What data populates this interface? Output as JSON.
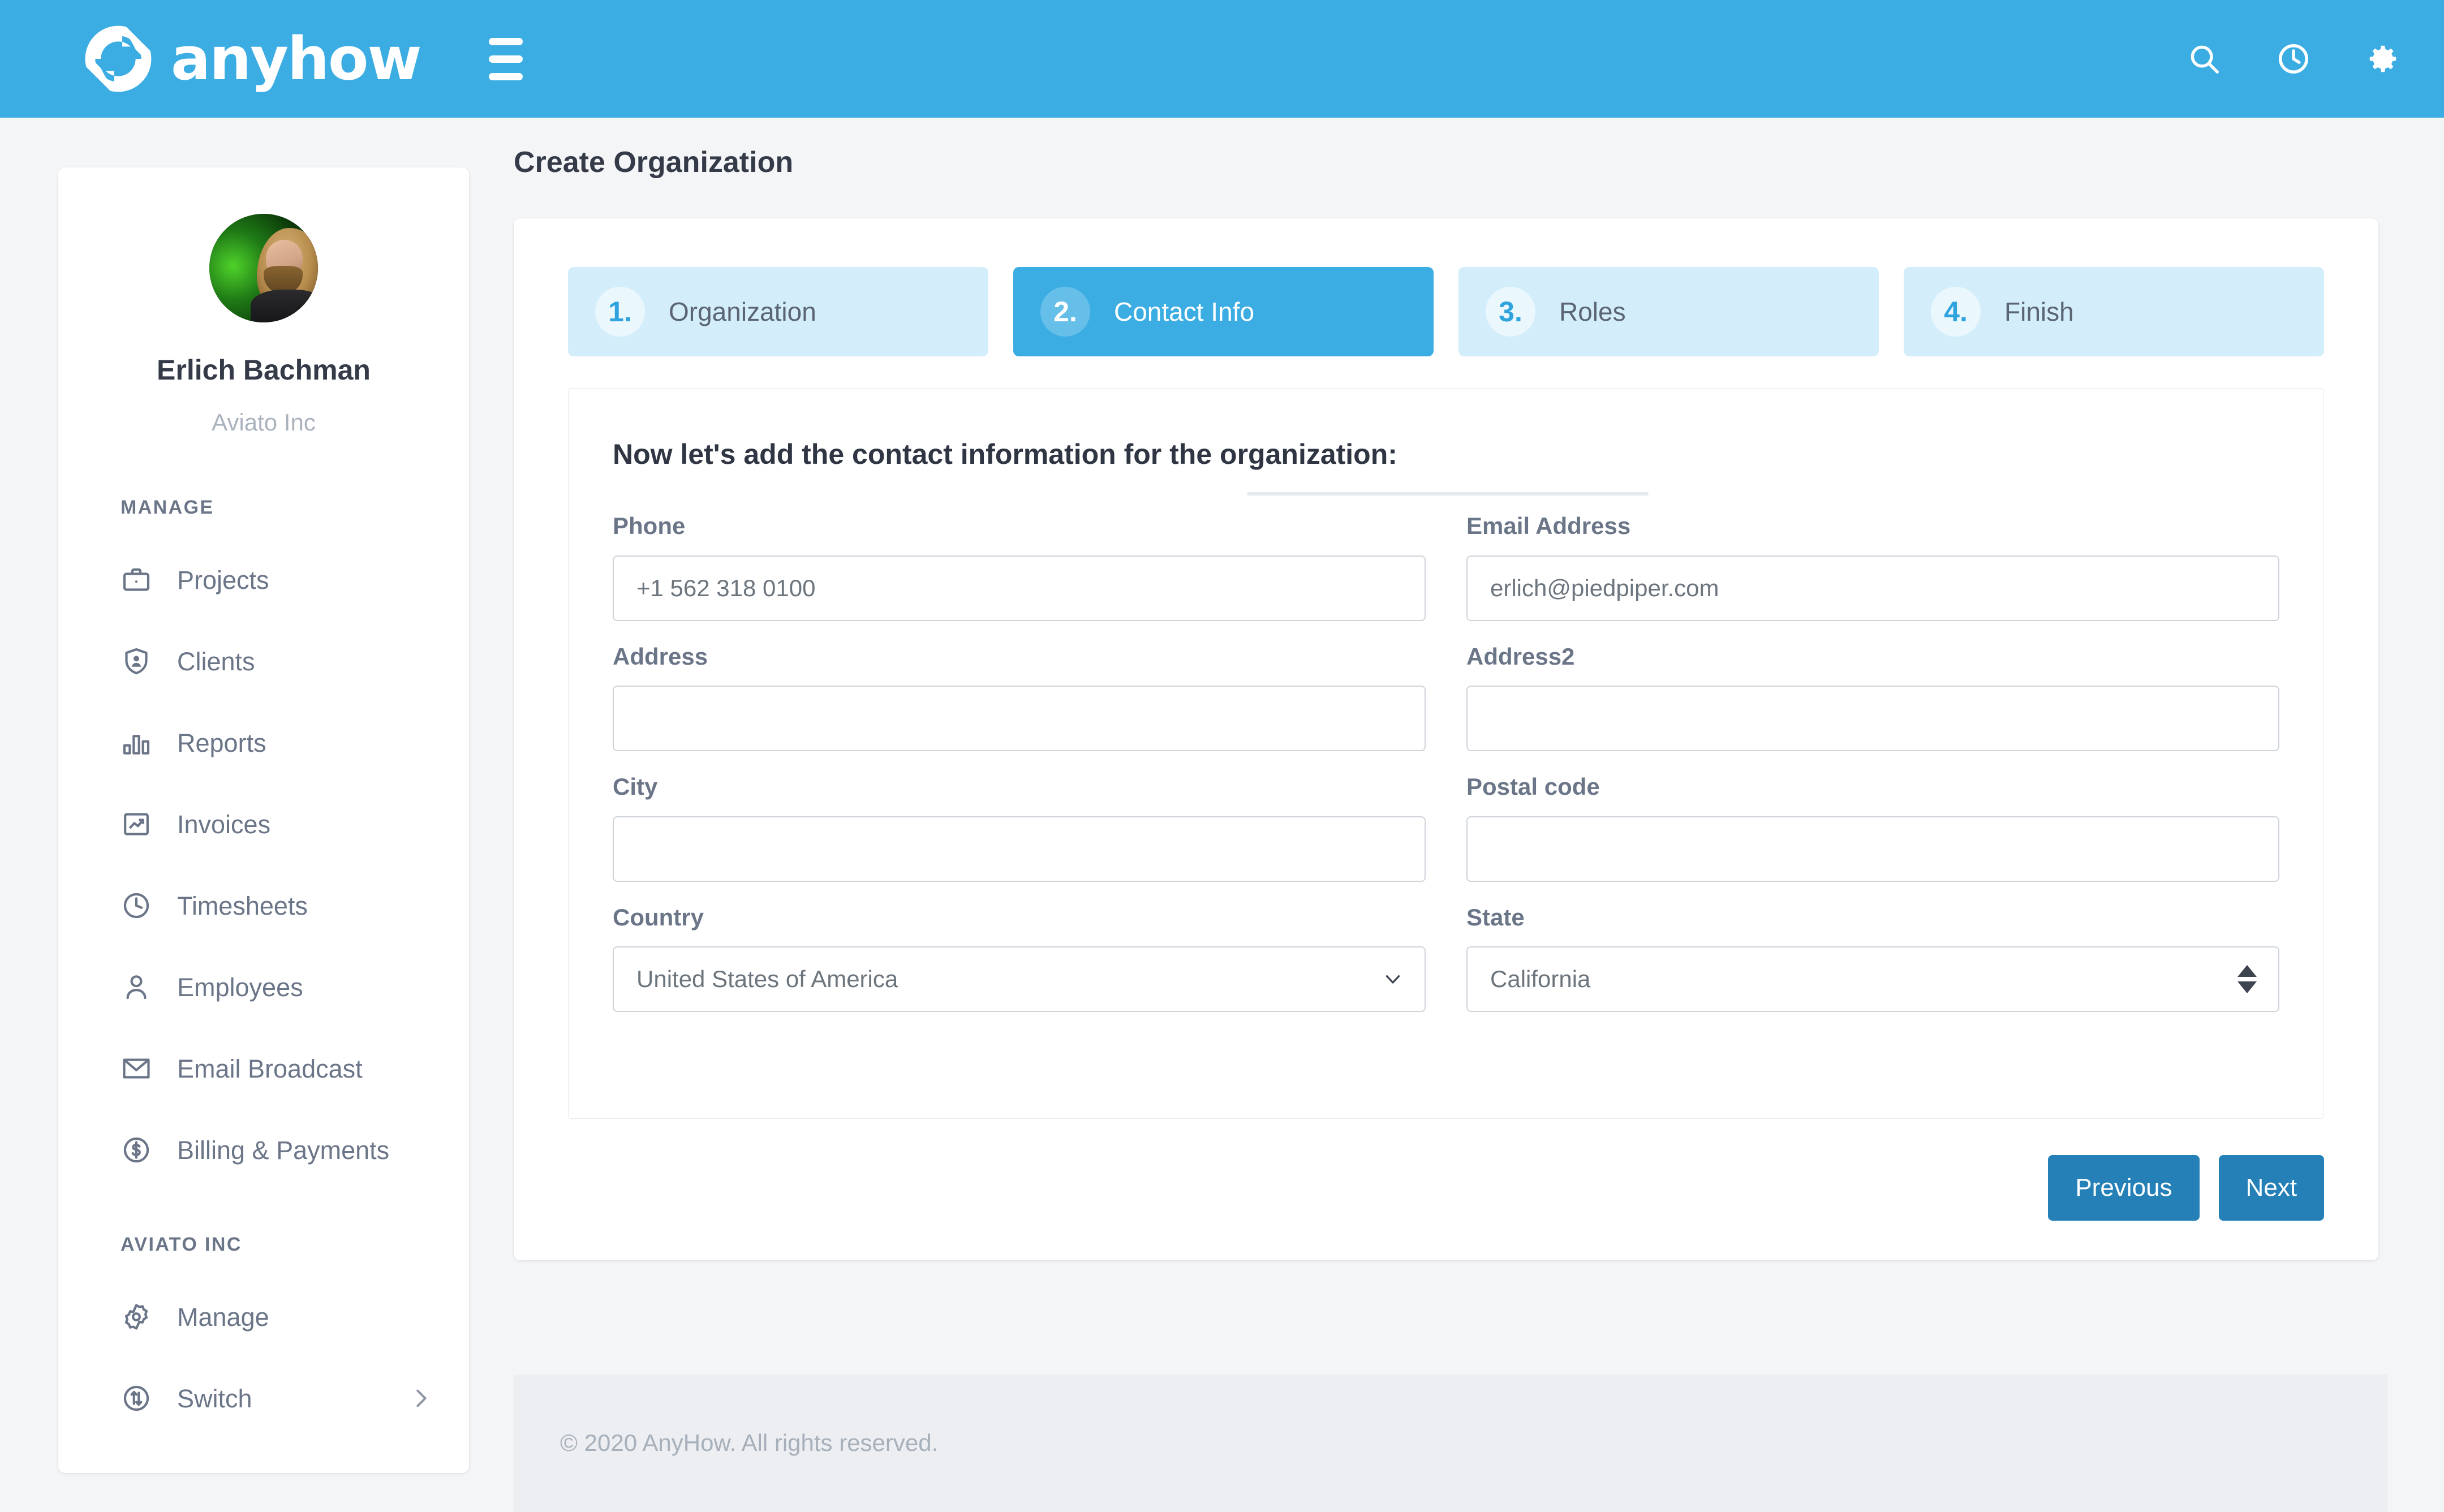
{
  "header": {
    "brand_name": "anyhow",
    "brand_icon": "anyhow-circular-arrows-logo",
    "menu_icon": "hamburger-menu-icon",
    "actions": [
      {
        "name": "search",
        "icon": "search-icon"
      },
      {
        "name": "history",
        "icon": "clock-icon"
      },
      {
        "name": "settings",
        "icon": "gear-icon"
      }
    ],
    "background_color": "#3bade3"
  },
  "sidebar": {
    "profile": {
      "name": "Erlich Bachman",
      "organization": "Aviato Inc",
      "avatar_icon": "avatar"
    },
    "sections": [
      {
        "title": "MANAGE",
        "items": [
          {
            "label": "Projects",
            "icon": "briefcase-icon"
          },
          {
            "label": "Clients",
            "icon": "shield-user-icon"
          },
          {
            "label": "Reports",
            "icon": "bar-chart-icon"
          },
          {
            "label": "Invoices",
            "icon": "chart-box-icon"
          },
          {
            "label": "Timesheets",
            "icon": "clock-icon"
          },
          {
            "label": "Employees",
            "icon": "person-icon"
          },
          {
            "label": "Email Broadcast",
            "icon": "envelope-icon"
          },
          {
            "label": "Billing & Payments",
            "icon": "dollar-circle-icon"
          }
        ]
      },
      {
        "title": "AVIATO INC",
        "items": [
          {
            "label": "Manage",
            "icon": "gear-icon"
          },
          {
            "label": "Switch",
            "icon": "switch-vertical-circle-icon",
            "caret": "chevron-right-icon"
          }
        ]
      }
    ]
  },
  "main": {
    "page_title": "Create Organization",
    "steps": [
      {
        "number": "1.",
        "label": "Organization",
        "active": false
      },
      {
        "number": "2.",
        "label": "Contact Info",
        "active": true
      },
      {
        "number": "3.",
        "label": "Roles",
        "active": false
      },
      {
        "number": "4.",
        "label": "Finish",
        "active": false
      }
    ],
    "form": {
      "heading": "Now let's add the contact information for the organization:",
      "fields": [
        {
          "label": "Phone",
          "value": "+1 562 318 0100",
          "type": "text",
          "name": "phone"
        },
        {
          "label": "Email Address",
          "value": "erlich@piedpiper.com",
          "type": "text",
          "name": "email-address"
        },
        {
          "label": "Address",
          "value": "",
          "type": "text",
          "name": "address"
        },
        {
          "label": "Address2",
          "value": "",
          "type": "text",
          "name": "address2"
        },
        {
          "label": "City",
          "value": "",
          "type": "text",
          "name": "city"
        },
        {
          "label": "Postal code",
          "value": "",
          "type": "text",
          "name": "postal-code"
        },
        {
          "label": "Country",
          "value": "United States of America",
          "type": "select-chevron",
          "name": "country"
        },
        {
          "label": "State",
          "value": "California",
          "type": "select-stepper",
          "name": "state"
        }
      ]
    },
    "buttons": {
      "previous": "Previous",
      "next": "Next"
    },
    "accent_color": "#3bade3",
    "button_color": "#2580b8"
  },
  "footer": {
    "copyright": "© 2020 AnyHow. All rights reserved."
  }
}
